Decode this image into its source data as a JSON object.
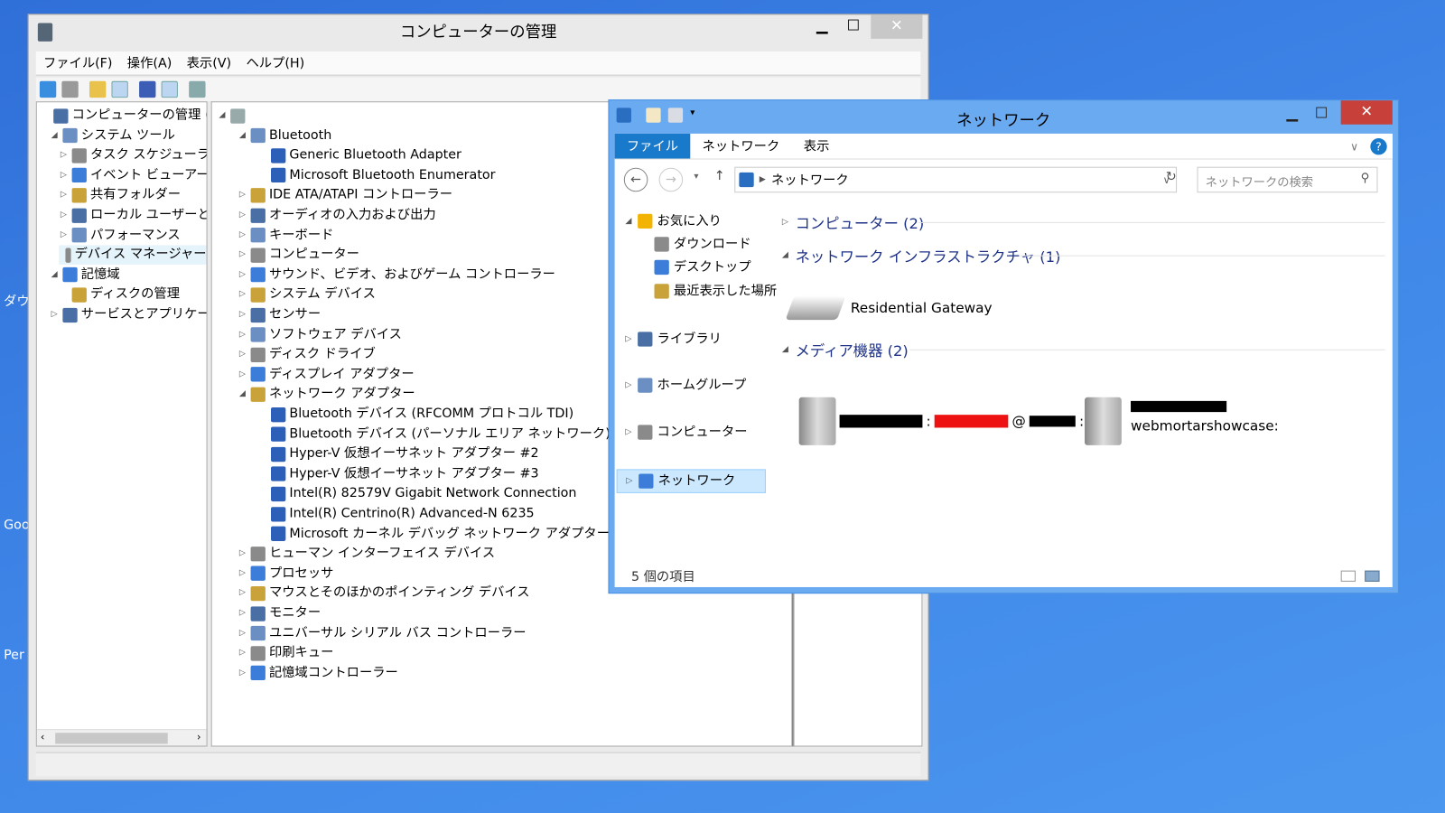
{
  "desktop": {
    "fragments": [
      "ダウ",
      "Goo",
      "Per"
    ]
  },
  "cm": {
    "title": "コンピューターの管理",
    "menu": [
      "ファイル(F)",
      "操作(A)",
      "表示(V)",
      "ヘルプ(H)"
    ],
    "left_tree": [
      {
        "label": "コンピューターの管理 (ローカ",
        "level": 0,
        "exp": ""
      },
      {
        "label": "システム ツール",
        "level": 1,
        "exp": "◢"
      },
      {
        "label": "タスク スケジューラ",
        "level": 2,
        "exp": "▷"
      },
      {
        "label": "イベント ビューアー",
        "level": 2,
        "exp": "▷"
      },
      {
        "label": "共有フォルダー",
        "level": 2,
        "exp": "▷"
      },
      {
        "label": "ローカル ユーザーとグ/",
        "level": 2,
        "exp": "▷"
      },
      {
        "label": "パフォーマンス",
        "level": 2,
        "exp": "▷"
      },
      {
        "label": "デバイス マネージャー",
        "level": 2,
        "exp": "",
        "selected": true
      },
      {
        "label": "記憶域",
        "level": 1,
        "exp": "◢"
      },
      {
        "label": "ディスクの管理",
        "level": 2,
        "exp": ""
      },
      {
        "label": "サービスとアプリケーション",
        "level": 1,
        "exp": "▷"
      }
    ],
    "devices": [
      {
        "label": "",
        "level": 0,
        "exp": "◢"
      },
      {
        "label": "Bluetooth",
        "level": 1,
        "exp": "◢"
      },
      {
        "label": "Generic Bluetooth Adapter",
        "level": 2,
        "exp": ""
      },
      {
        "label": "Microsoft Bluetooth Enumerator",
        "level": 2,
        "exp": ""
      },
      {
        "label": "IDE ATA/ATAPI コントローラー",
        "level": 1,
        "exp": "▷"
      },
      {
        "label": "オーディオの入力および出力",
        "level": 1,
        "exp": "▷"
      },
      {
        "label": "キーボード",
        "level": 1,
        "exp": "▷"
      },
      {
        "label": "コンピューター",
        "level": 1,
        "exp": "▷"
      },
      {
        "label": "サウンド、ビデオ、およびゲーム コントローラー",
        "level": 1,
        "exp": "▷"
      },
      {
        "label": "システム デバイス",
        "level": 1,
        "exp": "▷"
      },
      {
        "label": "センサー",
        "level": 1,
        "exp": "▷"
      },
      {
        "label": "ソフトウェア デバイス",
        "level": 1,
        "exp": "▷"
      },
      {
        "label": "ディスク ドライブ",
        "level": 1,
        "exp": "▷"
      },
      {
        "label": "ディスプレイ アダプター",
        "level": 1,
        "exp": "▷"
      },
      {
        "label": "ネットワーク アダプター",
        "level": 1,
        "exp": "◢"
      },
      {
        "label": "Bluetooth デバイス (RFCOMM プロトコル TDI)",
        "level": 2,
        "exp": ""
      },
      {
        "label": "Bluetooth デバイス (パーソナル エリア ネットワーク)",
        "level": 2,
        "exp": ""
      },
      {
        "label": "Hyper-V 仮想イーサネット アダプター #2",
        "level": 2,
        "exp": ""
      },
      {
        "label": "Hyper-V 仮想イーサネット アダプター #3",
        "level": 2,
        "exp": ""
      },
      {
        "label": "Intel(R) 82579V Gigabit Network Connection",
        "level": 2,
        "exp": ""
      },
      {
        "label": "Intel(R) Centrino(R) Advanced-N 6235",
        "level": 2,
        "exp": ""
      },
      {
        "label": "Microsoft カーネル デバッグ ネットワーク アダプター",
        "level": 2,
        "exp": ""
      },
      {
        "label": "ヒューマン インターフェイス デバイス",
        "level": 1,
        "exp": "▷"
      },
      {
        "label": "プロセッサ",
        "level": 1,
        "exp": "▷"
      },
      {
        "label": "マウスとそのほかのポインティング デバイス",
        "level": 1,
        "exp": "▷"
      },
      {
        "label": "モニター",
        "level": 1,
        "exp": "▷"
      },
      {
        "label": "ユニバーサル シリアル バス コントローラー",
        "level": 1,
        "exp": "▷"
      },
      {
        "label": "印刷キュー",
        "level": 1,
        "exp": "▷"
      },
      {
        "label": "記憶域コントローラー",
        "level": 1,
        "exp": "▷"
      }
    ]
  },
  "nw": {
    "title": "ネットワーク",
    "ribbon": [
      "ファイル",
      "ネットワーク",
      "表示"
    ],
    "address": "ネットワーク",
    "search_placeholder": "ネットワークの検索",
    "nav": [
      {
        "label": "お気に入り",
        "exp": "◢",
        "indent": 0
      },
      {
        "label": "ダウンロード",
        "exp": "",
        "indent": 1
      },
      {
        "label": "デスクトップ",
        "exp": "",
        "indent": 1
      },
      {
        "label": "最近表示した場所",
        "exp": "",
        "indent": 1
      },
      {
        "label": "ライブラリ",
        "exp": "▷",
        "indent": 0
      },
      {
        "label": "ホームグループ",
        "exp": "▷",
        "indent": 0
      },
      {
        "label": "コンピューター",
        "exp": "▷",
        "indent": 0
      },
      {
        "label": "ネットワーク",
        "exp": "▷",
        "indent": 0,
        "selected": true
      }
    ],
    "groups": [
      {
        "label": "コンピューター (2)",
        "exp": "▷"
      },
      {
        "label": "ネットワーク インフラストラクチャ (1)",
        "exp": "◢"
      },
      {
        "label": "メディア機器 (2)",
        "exp": "◢"
      }
    ],
    "gateway": "Residential Gateway",
    "media": [
      {
        "sep1": ":",
        "sep2": "@",
        "tail": ":"
      },
      {
        "label": "webmortarshowcase:"
      }
    ],
    "status": "5 個の項目",
    "colors": {
      "accent": "#1979ca",
      "close": "#c7403a",
      "selected": "#cce8ff"
    }
  }
}
